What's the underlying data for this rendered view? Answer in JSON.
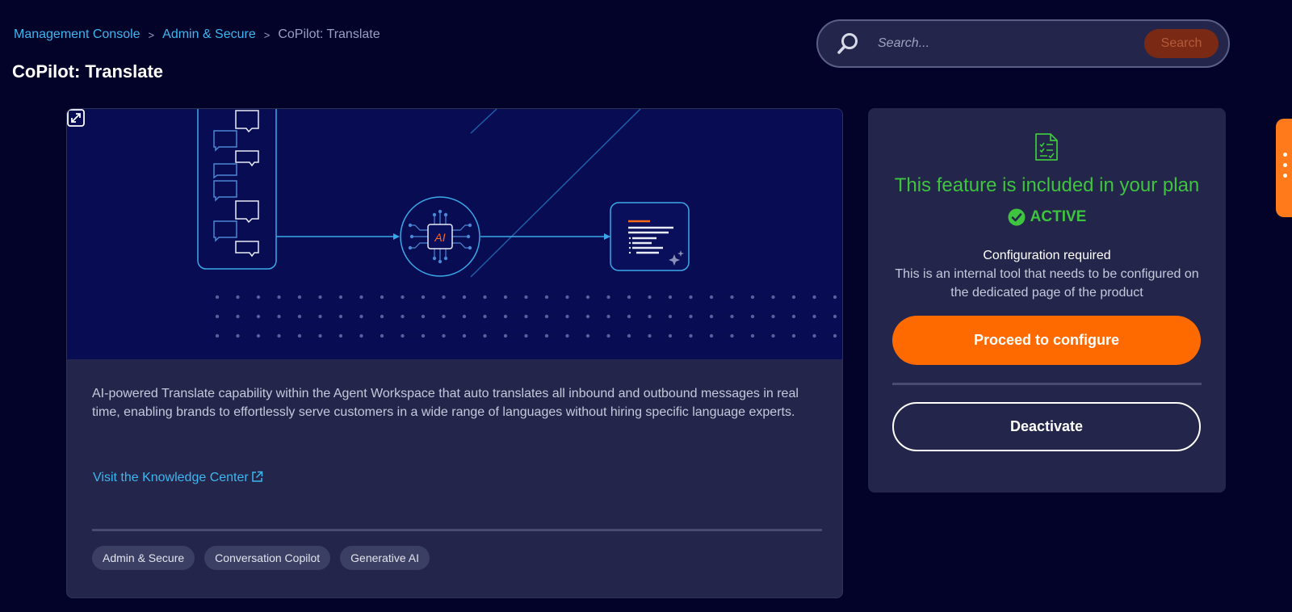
{
  "breadcrumb": {
    "items": [
      "Management Console",
      "Admin & Secure"
    ],
    "separator": ">",
    "current": "CoPilot: Translate"
  },
  "page": {
    "title": "CoPilot: Translate"
  },
  "search": {
    "placeholder": "Search...",
    "button_label": "Search"
  },
  "feature": {
    "hero_chip_label": "AI",
    "description": "AI-powered Translate capability within the Agent Workspace that auto translates all inbound and outbound messages in real time, enabling brands to effortlessly serve customers in a wide range of languages without hiring specific language experts.",
    "knowledge_link": "Visit the Knowledge Center",
    "tags": [
      "Admin & Secure",
      "Conversation Copilot",
      "Generative AI"
    ]
  },
  "plan": {
    "included_text": "This feature is included in your plan",
    "status": "ACTIVE",
    "config_title": "Configuration required",
    "config_desc": "This is an internal tool that needs to be configured on the dedicated page of the product",
    "proceed_label": "Proceed to configure",
    "deactivate_label": "Deactivate"
  },
  "colors": {
    "background": "#03032a",
    "card": "#23264a",
    "hero": "#080c52",
    "accent_orange": "#ff6a00",
    "link_blue": "#3eb6f0",
    "success_green": "#3ec43e"
  },
  "icons": {
    "search": "search-icon",
    "expand": "expand-icon",
    "external_link": "external-link-icon",
    "document_check": "document-check-icon",
    "check_circle": "check-circle-icon",
    "side_menu": "vertical-dots-icon"
  }
}
